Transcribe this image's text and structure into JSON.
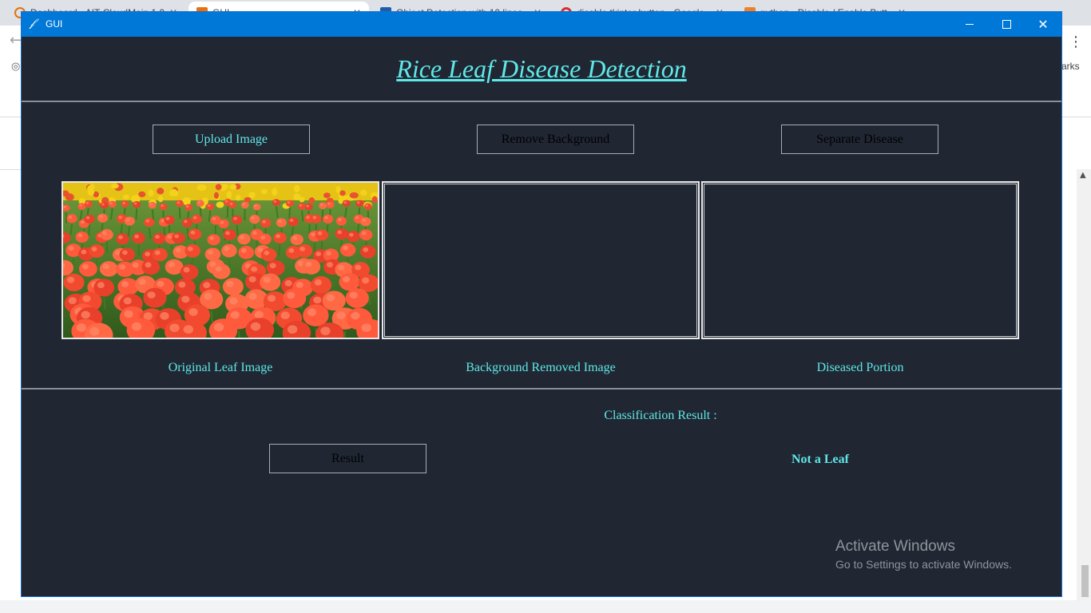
{
  "window": {
    "title": "GUI",
    "icon": "feather-icon"
  },
  "browser": {
    "tabs": [
      {
        "label": "Dashboard - AIT-CloudMain 1.0"
      },
      {
        "label": "GUI"
      },
      {
        "label": "Object Detection with 10 lines"
      },
      {
        "label": "disable tkinter button - Google"
      },
      {
        "label": "python - Disable / Enable Butt"
      }
    ],
    "bookmarks_text": "arks"
  },
  "app": {
    "title": "Rice Leaf Disease Detection",
    "buttons": {
      "upload": "Upload Image",
      "remove_bg": "Remove Background",
      "separate": "Separate Disease",
      "result": "Result"
    },
    "captions": {
      "original": "Original Leaf Image",
      "bg_removed": "Background Removed Image",
      "diseased": "Diseased Portion"
    },
    "classification_label": "Classification Result :",
    "classification_value": "Not a Leaf"
  },
  "os": {
    "activate_title": "Activate Windows",
    "activate_sub": "Go to Settings to activate Windows."
  },
  "colors": {
    "app_bg": "#202632",
    "accent_text": "#5fe8e8",
    "titlebar": "#0078d7"
  }
}
